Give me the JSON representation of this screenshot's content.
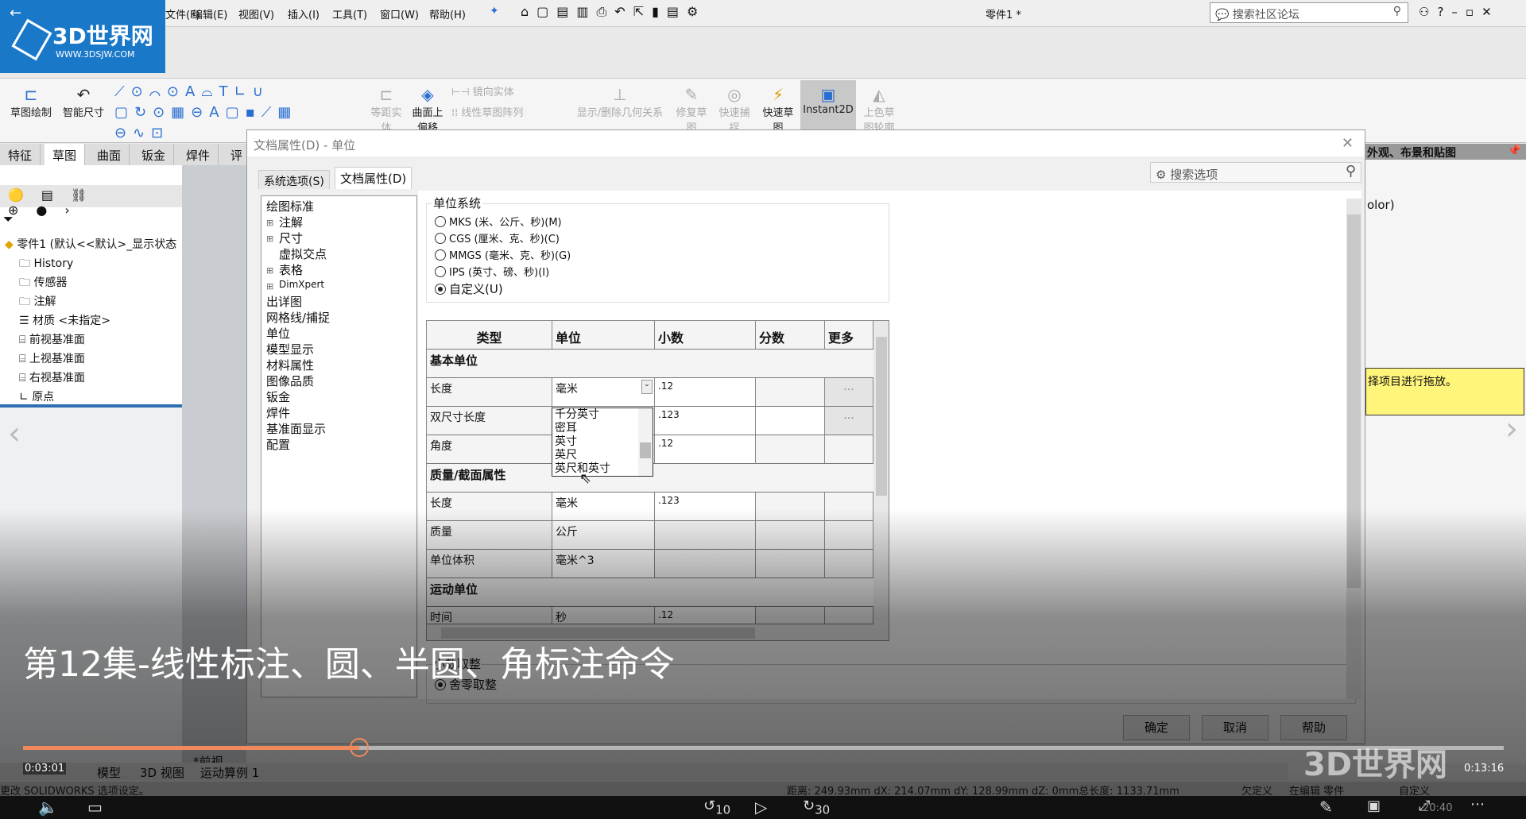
{
  "app": {
    "title": "零件1 *",
    "search_placeholder": "搜索社区论坛",
    "menus": [
      "文件(F)",
      "编辑(E)",
      "视图(V)",
      "插入(I)",
      "工具(T)",
      "窗口(W)",
      "帮助(H)"
    ]
  },
  "logo": {
    "name": "3D世界网",
    "url": "WWW.3DSJW.COM"
  },
  "ribbon": {
    "items": [
      "草图绘制",
      "智能尺寸",
      "等距实体",
      "曲面上偏移",
      "镜向实体",
      "线性草图阵列",
      "显示/删除几何关系",
      "修复草图",
      "快速捕捉",
      "快速草图",
      "Instant2D",
      "上色草图轮廓"
    ]
  },
  "cmd_tabs": [
    "特征",
    "草图",
    "曲面",
    "钣金",
    "焊件",
    "评"
  ],
  "feature_tree": {
    "root": "零件1  (默认<<默认>_显示状态",
    "items": [
      "History",
      "传感器",
      "注解",
      "材质 <未指定>",
      "前视基准面",
      "上视基准面",
      "右视基准面",
      "原点"
    ]
  },
  "dialog": {
    "title": "文档属性(D) - 单位",
    "tabs": [
      "系统选项(S)",
      "文档属性(D)"
    ],
    "search_placeholder": "搜索选项",
    "tree": [
      "绘图标准",
      "注解",
      "尺寸",
      "虚拟交点",
      "表格",
      "DimXpert",
      "出详图",
      "网格线/捕捉",
      "单位",
      "模型显示",
      "材料属性",
      "图像品质",
      "钣金",
      "焊件",
      "基准面显示",
      "配置"
    ],
    "unit_system": {
      "label": "单位系统",
      "options": [
        "MKS (米、公斤、秒)(M)",
        "CGS (厘米、克、秒)(C)",
        "MMGS (毫米、克、秒)(G)",
        "IPS (英寸、磅、秒)(I)",
        "自定义(U)"
      ],
      "selected": "自定义(U)"
    },
    "table": {
      "headers": [
        "类型",
        "单位",
        "小数",
        "分数",
        "更多"
      ],
      "rows": [
        {
          "section": "基本单位"
        },
        {
          "type": "长度",
          "unit": "毫米",
          "decimal": ".12",
          "more": "..."
        },
        {
          "type": "双尺寸长度",
          "unit": "",
          "decimal": ".123",
          "more": "..."
        },
        {
          "type": "角度",
          "unit": "",
          "decimal": ".12"
        },
        {
          "section": "质量/截面属性"
        },
        {
          "type": "长度",
          "unit": "毫米",
          "decimal": ".123"
        },
        {
          "type": "质量",
          "unit": "公斤",
          "decimal": ""
        },
        {
          "type": "单位体积",
          "unit": "毫米^3",
          "decimal": ""
        },
        {
          "section": "运动单位"
        },
        {
          "type": "时间",
          "unit": "秒",
          "decimal": ".12"
        }
      ]
    },
    "dropdown_options": [
      "千分英寸",
      "密耳",
      "英寸",
      "英尺",
      "英尺和英寸"
    ],
    "rounding": {
      "label": "小数取整",
      "option": "舍零取整"
    },
    "buttons": {
      "ok": "确定",
      "cancel": "取消",
      "help": "帮助"
    }
  },
  "right_panel": {
    "title": "外观、布景和贴图",
    "text": "olor)",
    "hint": "择项目进行拖放。"
  },
  "view_label": "*前视",
  "bottom_tabs": [
    "模型",
    "3D 视图",
    "运动算例 1"
  ],
  "status": {
    "left": "更改 SOLIDWORKS 选项设定。",
    "measure": "距离: 249.93mm  dX: 214.07mm  dY: 128.99mm  dZ: 0mm总长度: 1133.71mm",
    "state": "欠定义",
    "edit": "在编辑 零件",
    "custom": "自定义"
  },
  "video": {
    "subtitle": "第12集-线性标注、圆、半圆、角标注命令",
    "current": "0:03:01",
    "total": "0:13:16",
    "progress_percent": 22.7,
    "rewind": "10",
    "forward": "30",
    "clock": "20:40"
  }
}
